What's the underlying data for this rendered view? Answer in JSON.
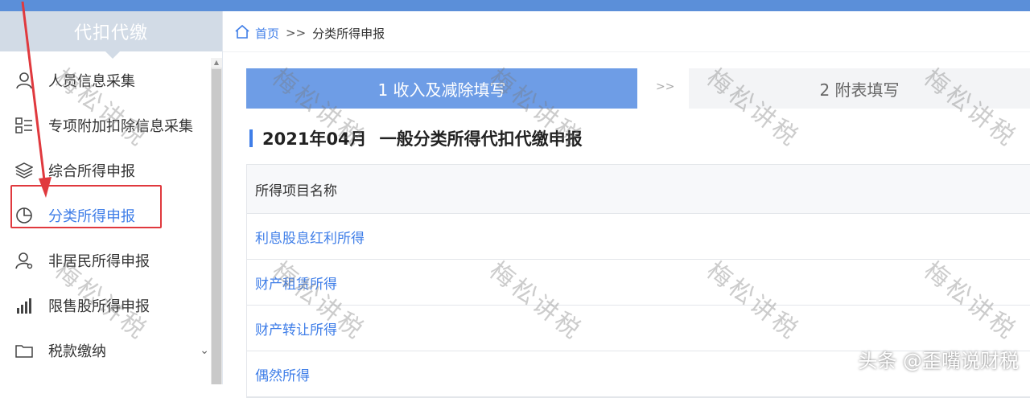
{
  "sidebar": {
    "header": "代扣代缴",
    "items": [
      {
        "label": "人员信息采集",
        "icon": "person-icon"
      },
      {
        "label": "专项附加扣除信息采集",
        "icon": "list-icon"
      },
      {
        "label": "综合所得申报",
        "icon": "layers-icon"
      },
      {
        "label": "分类所得申报",
        "icon": "pie-chart-icon",
        "active": true
      },
      {
        "label": "非居民所得申报",
        "icon": "person-settings-icon"
      },
      {
        "label": "限售股所得申报",
        "icon": "bar-chart-icon"
      },
      {
        "label": "税款缴纳",
        "icon": "folder-icon"
      }
    ],
    "caret": "⌄"
  },
  "breadcrumb": {
    "home": "首页",
    "separator": ">>",
    "current": "分类所得申报"
  },
  "steps": {
    "step1": "1 收入及减除填写",
    "arrow": ">>",
    "step2": "2 附表填写"
  },
  "section": {
    "period": "2021年04月",
    "title": "一般分类所得代扣代缴申报"
  },
  "table": {
    "header": "所得项目名称",
    "rows": [
      "利息股息红利所得",
      "财产租赁所得",
      "财产转让所得",
      "偶然所得"
    ]
  },
  "watermark": "梅松讲税",
  "credit": "头条 @歪嘴说财税",
  "colors": {
    "accent": "#3f7ee8",
    "step_active": "#6e9de6",
    "highlight": "#e0393e"
  }
}
